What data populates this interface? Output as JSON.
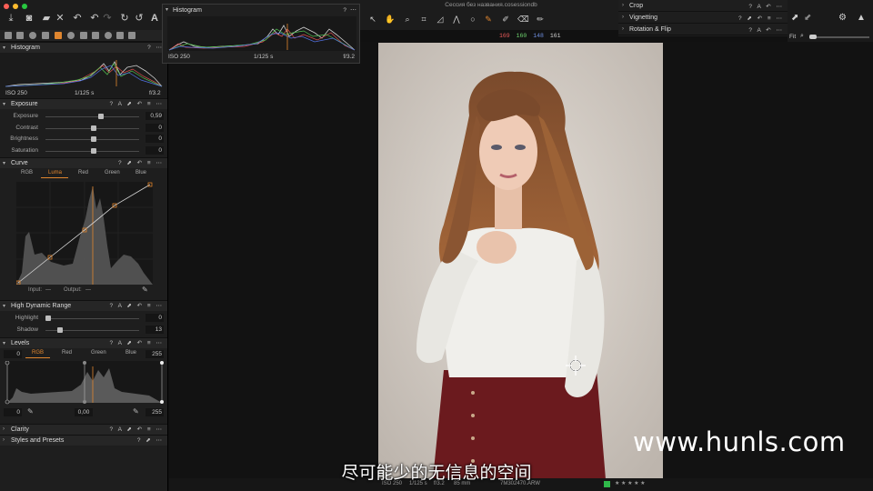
{
  "window": {
    "title": "Сессия без названия.cosessiondb"
  },
  "traffic_colors": {
    "close": "#ff5f57",
    "minimize": "#febc2e",
    "zoom": "#28c840"
  },
  "accent_color": "#e0862f",
  "rgb_readout": {
    "r": "169",
    "g": "160",
    "b": "148",
    "l": "161"
  },
  "float_histogram": {
    "title": "Histogram",
    "iso": "ISO 250",
    "shutter": "1/125 s",
    "aperture": "f/3.2",
    "help": "?",
    "more": "⋯"
  },
  "left": {
    "histogram": {
      "title": "Histogram",
      "iso": "ISO 250",
      "shutter": "1/125 s",
      "aperture": "f/3.2"
    },
    "exposure": {
      "title": "Exposure",
      "rows": [
        {
          "label": "Exposure",
          "value": "0,59",
          "level": 0.58
        },
        {
          "label": "Contrast",
          "value": "0",
          "level": 0.5
        },
        {
          "label": "Brightness",
          "value": "0",
          "level": 0.5
        },
        {
          "label": "Saturation",
          "value": "0",
          "level": 0.5
        }
      ]
    },
    "curve": {
      "title": "Curve",
      "tabs": [
        "RGB",
        "Luma",
        "Red",
        "Green",
        "Blue"
      ],
      "active_tab": "Luma",
      "input_label": "Input:",
      "input_value": "—",
      "output_label": "Output:",
      "output_value": "—"
    },
    "hdr": {
      "title": "High Dynamic Range",
      "rows": [
        {
          "label": "Highlight",
          "value": "0",
          "level": 0.0
        },
        {
          "label": "Shadow",
          "value": "13",
          "level": 0.13
        }
      ]
    },
    "levels": {
      "title": "Levels",
      "tabs": [
        "RGB",
        "Red",
        "Green",
        "Blue"
      ],
      "active_tab": "RGB",
      "top_left": "0",
      "top_right": "255",
      "bottom_left": "0",
      "bottom_mid": "0,00",
      "bottom_right": "255"
    },
    "clarity": {
      "title": "Clarity"
    },
    "styles": {
      "title": "Styles and Presets"
    }
  },
  "right": {
    "items": [
      {
        "title": "Crop"
      },
      {
        "title": "Vignetting"
      },
      {
        "title": "Rotation & Flip"
      }
    ],
    "fit_label": "Fit"
  },
  "status": {
    "iso": "ISO 250",
    "shutter": "1/125 s",
    "aperture": "f/3.2",
    "focal": "85 mm",
    "filename": "7M302470.ARW",
    "rating_stars": "★ ★ ★ ★ ★"
  },
  "subtitle": "尽可能少的无信息的空间",
  "watermark": "www.hunls.com"
}
